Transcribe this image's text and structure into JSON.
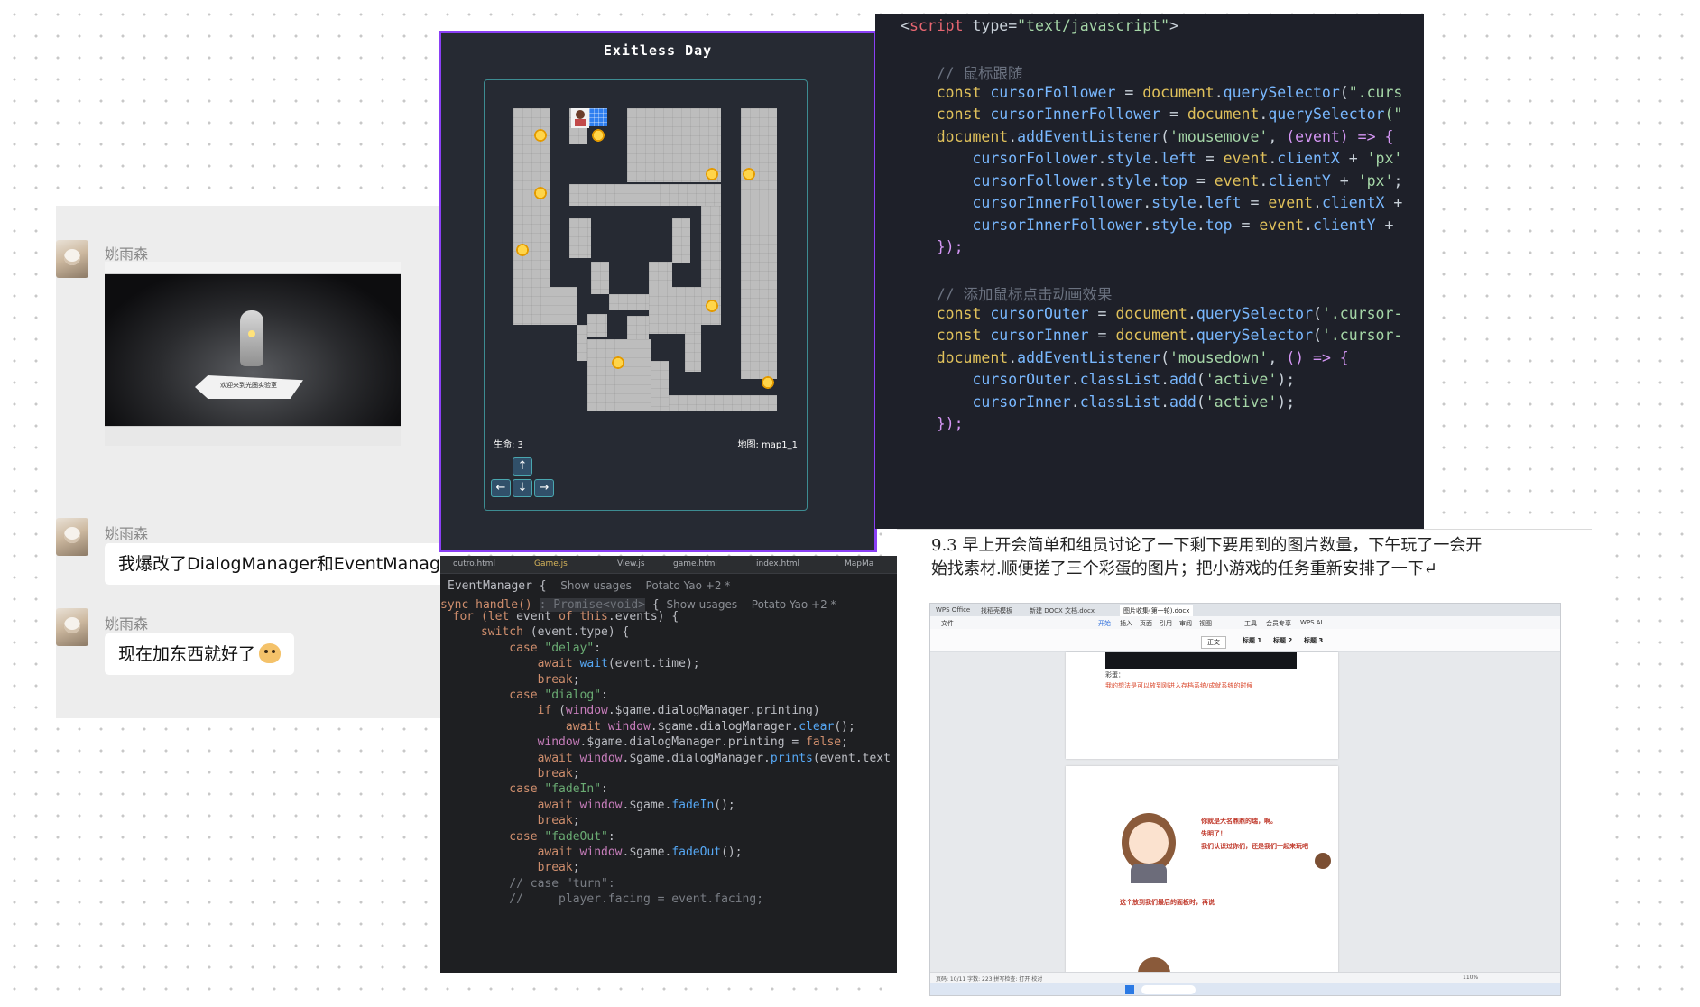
{
  "chat": {
    "messages": [
      {
        "sender": "姚雨森",
        "type": "image"
      },
      {
        "sender": "姚雨森",
        "text": "我爆改了DialogManager和EventManager"
      },
      {
        "sender": "姚雨森",
        "text": "现在加东西就好了"
      }
    ],
    "image_caption": "欢迎来到光圈实验室"
  },
  "game": {
    "title": "Exitless Day",
    "lives_label": "生命: 3",
    "map_label": "地图: map1_1",
    "controls": {
      "up": "↑",
      "left": "←",
      "down": "↓",
      "right": "→"
    },
    "colors": {
      "border": "#8a3ff5",
      "wall": "#bdbdbd",
      "goal": "#2f7ff0",
      "gem": "#f2b400"
    }
  },
  "codeA": {
    "lines": [
      [
        [
          "<",
          "#c9d1d9"
        ],
        [
          "script",
          "#e86671"
        ],
        [
          " type=",
          "#c9d1d9"
        ],
        [
          "\"text/javascript\"",
          "#a5d6a7"
        ],
        [
          ">",
          "#c9d1d9"
        ]
      ],
      [],
      [
        [
          "    // 鼠标跟随",
          "#6b7280"
        ]
      ],
      [
        [
          "    const ",
          "#e0c15b"
        ],
        [
          "cursorFollower",
          "#79b8ff"
        ],
        [
          " = ",
          "#c9d1d9"
        ],
        [
          "document",
          "#e0c15b"
        ],
        [
          ".",
          "#c9d1d9"
        ],
        [
          "querySelector",
          "#79b8ff"
        ],
        [
          "(",
          "#c9d1d9"
        ],
        [
          "\".curs",
          "#a5d6a7"
        ]
      ],
      [
        [
          "    const ",
          "#e0c15b"
        ],
        [
          "cursorInnerFollower",
          "#79b8ff"
        ],
        [
          " = ",
          "#c9d1d9"
        ],
        [
          "document",
          "#e0c15b"
        ],
        [
          ".",
          "#c9d1d9"
        ],
        [
          "querySelector",
          "#79b8ff"
        ],
        [
          "(\"",
          "#a5d6a7"
        ]
      ],
      [
        [
          "    document",
          "#e0c15b"
        ],
        [
          ".",
          "#c9d1d9"
        ],
        [
          "addEventListener",
          "#79b8ff"
        ],
        [
          "(",
          "#c9d1d9"
        ],
        [
          "'mousemove'",
          "#a5d6a7"
        ],
        [
          ", ",
          "#c9d1d9"
        ],
        [
          "(event) => {",
          "#d596f5"
        ]
      ],
      [
        [
          "        cursorFollower",
          "#79b8ff"
        ],
        [
          ".",
          "#c9d1d9"
        ],
        [
          "style",
          "#79b8ff"
        ],
        [
          ".",
          "#c9d1d9"
        ],
        [
          "left",
          "#79b8ff"
        ],
        [
          " = ",
          "#c9d1d9"
        ],
        [
          "event",
          "#e0c15b"
        ],
        [
          ".",
          "#c9d1d9"
        ],
        [
          "clientX",
          "#79b8ff"
        ],
        [
          " + ",
          "#c9d1d9"
        ],
        [
          "'px'",
          "#a5d6a7"
        ]
      ],
      [
        [
          "        cursorFollower",
          "#79b8ff"
        ],
        [
          ".",
          "#c9d1d9"
        ],
        [
          "style",
          "#79b8ff"
        ],
        [
          ".",
          "#c9d1d9"
        ],
        [
          "top",
          "#79b8ff"
        ],
        [
          " = ",
          "#c9d1d9"
        ],
        [
          "event",
          "#e0c15b"
        ],
        [
          ".",
          "#c9d1d9"
        ],
        [
          "clientY",
          "#79b8ff"
        ],
        [
          " + ",
          "#c9d1d9"
        ],
        [
          "'px'",
          "#a5d6a7"
        ],
        [
          ";",
          "#c9d1d9"
        ]
      ],
      [
        [
          "        cursorInnerFollower",
          "#79b8ff"
        ],
        [
          ".",
          "#c9d1d9"
        ],
        [
          "style",
          "#79b8ff"
        ],
        [
          ".",
          "#c9d1d9"
        ],
        [
          "left",
          "#79b8ff"
        ],
        [
          " = ",
          "#c9d1d9"
        ],
        [
          "event",
          "#e0c15b"
        ],
        [
          ".",
          "#c9d1d9"
        ],
        [
          "clientX",
          "#79b8ff"
        ],
        [
          " +",
          "#c9d1d9"
        ]
      ],
      [
        [
          "        cursorInnerFollower",
          "#79b8ff"
        ],
        [
          ".",
          "#c9d1d9"
        ],
        [
          "style",
          "#79b8ff"
        ],
        [
          ".",
          "#c9d1d9"
        ],
        [
          "top",
          "#79b8ff"
        ],
        [
          " = ",
          "#c9d1d9"
        ],
        [
          "event",
          "#e0c15b"
        ],
        [
          ".",
          "#c9d1d9"
        ],
        [
          "clientY",
          "#79b8ff"
        ],
        [
          " +",
          "#c9d1d9"
        ]
      ],
      [
        [
          "    });",
          "#d596f5"
        ]
      ],
      [],
      [
        [
          "    // 添加鼠标点击动画效果",
          "#6b7280"
        ]
      ],
      [
        [
          "    const ",
          "#e0c15b"
        ],
        [
          "cursorOuter",
          "#79b8ff"
        ],
        [
          " = ",
          "#c9d1d9"
        ],
        [
          "document",
          "#e0c15b"
        ],
        [
          ".",
          "#c9d1d9"
        ],
        [
          "querySelector",
          "#79b8ff"
        ],
        [
          "(",
          "#c9d1d9"
        ],
        [
          "'.cursor-",
          "#a5d6a7"
        ]
      ],
      [
        [
          "    const ",
          "#e0c15b"
        ],
        [
          "cursorInner",
          "#79b8ff"
        ],
        [
          " = ",
          "#c9d1d9"
        ],
        [
          "document",
          "#e0c15b"
        ],
        [
          ".",
          "#c9d1d9"
        ],
        [
          "querySelector",
          "#79b8ff"
        ],
        [
          "(",
          "#c9d1d9"
        ],
        [
          "'.cursor-",
          "#a5d6a7"
        ]
      ],
      [
        [
          "    document",
          "#e0c15b"
        ],
        [
          ".",
          "#c9d1d9"
        ],
        [
          "addEventListener",
          "#79b8ff"
        ],
        [
          "(",
          "#c9d1d9"
        ],
        [
          "'mousedown'",
          "#a5d6a7"
        ],
        [
          ", ",
          "#c9d1d9"
        ],
        [
          "() => {",
          "#d596f5"
        ]
      ],
      [
        [
          "        cursorOuter",
          "#79b8ff"
        ],
        [
          ".",
          "#c9d1d9"
        ],
        [
          "classList",
          "#79b8ff"
        ],
        [
          ".",
          "#c9d1d9"
        ],
        [
          "add",
          "#79b8ff"
        ],
        [
          "(",
          "#c9d1d9"
        ],
        [
          "'active'",
          "#a5d6a7"
        ],
        [
          ");",
          "#c9d1d9"
        ]
      ],
      [
        [
          "        cursorInner",
          "#79b8ff"
        ],
        [
          ".",
          "#c9d1d9"
        ],
        [
          "classList",
          "#79b8ff"
        ],
        [
          ".",
          "#c9d1d9"
        ],
        [
          "add",
          "#79b8ff"
        ],
        [
          "(",
          "#c9d1d9"
        ],
        [
          "'active'",
          "#a5d6a7"
        ],
        [
          ");",
          "#c9d1d9"
        ]
      ],
      [
        [
          "    });",
          "#d596f5"
        ]
      ]
    ]
  },
  "codeB": {
    "tabs": [
      "outro.html",
      "Game.js",
      "View.js",
      "game.html",
      "index.html",
      "MapMa"
    ],
    "header_class": "EventManager {",
    "header_usages": "Show usages",
    "header_author": "Potato Yao +2 *",
    "method_sig": "sync handle()",
    "method_hint": ": Promise<void>",
    "lines": [
      [
        [
          "  for (",
          "#cf8e6d"
        ],
        [
          "let ",
          "#cf8e6d"
        ],
        [
          "event ",
          "#bcbec4"
        ],
        [
          "of ",
          "#cf8e6d"
        ],
        [
          "this",
          "#cf8e6d"
        ],
        [
          ".events) {",
          "#bcbec4"
        ]
      ],
      [
        [
          "      switch ",
          "#cf8e6d"
        ],
        [
          "(event.type) {",
          "#bcbec4"
        ]
      ],
      [
        [
          "          case ",
          "#cf8e6d"
        ],
        [
          "\"delay\"",
          "#6aab73"
        ],
        [
          ":",
          "#bcbec4"
        ]
      ],
      [
        [
          "              await ",
          "#cf8e6d"
        ],
        [
          "wait",
          "#56a8f5"
        ],
        [
          "(event.time);",
          "#bcbec4"
        ]
      ],
      [
        [
          "              break",
          "#cf8e6d"
        ],
        [
          ";",
          "#bcbec4"
        ]
      ],
      [
        [
          "          case ",
          "#cf8e6d"
        ],
        [
          "\"dialog\"",
          "#6aab73"
        ],
        [
          ":",
          "#bcbec4"
        ]
      ],
      [
        [
          "              if ",
          "#cf8e6d"
        ],
        [
          "(",
          "#bcbec4"
        ],
        [
          "window",
          "#c77dbb"
        ],
        [
          ".$game.dialogManager.printing)",
          "#bcbec4"
        ]
      ],
      [
        [
          "                  await ",
          "#cf8e6d"
        ],
        [
          "window",
          "#c77dbb"
        ],
        [
          ".$game.dialogManager.",
          "#bcbec4"
        ],
        [
          "clear",
          "#56a8f5"
        ],
        [
          "();",
          "#bcbec4"
        ]
      ],
      [
        [
          "              window",
          "#c77dbb"
        ],
        [
          ".$game.dialogManager.printing = ",
          "#bcbec4"
        ],
        [
          "false",
          "#cf8e6d"
        ],
        [
          ";",
          "#bcbec4"
        ]
      ],
      [
        [
          "              await ",
          "#cf8e6d"
        ],
        [
          "window",
          "#c77dbb"
        ],
        [
          ".$game.dialogManager.",
          "#bcbec4"
        ],
        [
          "prints",
          "#56a8f5"
        ],
        [
          "(event.text",
          "#bcbec4"
        ]
      ],
      [
        [
          "              break",
          "#cf8e6d"
        ],
        [
          ";",
          "#bcbec4"
        ]
      ],
      [
        [
          "          case ",
          "#cf8e6d"
        ],
        [
          "\"fadeIn\"",
          "#6aab73"
        ],
        [
          ":",
          "#bcbec4"
        ]
      ],
      [
        [
          "              await ",
          "#cf8e6d"
        ],
        [
          "window",
          "#c77dbb"
        ],
        [
          ".$game.",
          "#bcbec4"
        ],
        [
          "fadeIn",
          "#56a8f5"
        ],
        [
          "();",
          "#bcbec4"
        ]
      ],
      [
        [
          "              break",
          "#cf8e6d"
        ],
        [
          ";",
          "#bcbec4"
        ]
      ],
      [
        [
          "          case ",
          "#cf8e6d"
        ],
        [
          "\"fadeOut\"",
          "#6aab73"
        ],
        [
          ":",
          "#bcbec4"
        ]
      ],
      [
        [
          "              await ",
          "#cf8e6d"
        ],
        [
          "window",
          "#c77dbb"
        ],
        [
          ".$game.",
          "#bcbec4"
        ],
        [
          "fadeOut",
          "#56a8f5"
        ],
        [
          "();",
          "#bcbec4"
        ]
      ],
      [
        [
          "              break",
          "#cf8e6d"
        ],
        [
          ";",
          "#bcbec4"
        ]
      ],
      [
        [
          "          // case \"turn\":",
          "#7a7e85"
        ]
      ],
      [
        [
          "          //     player.facing = event.facing;",
          "#7a7e85"
        ]
      ]
    ]
  },
  "doc": {
    "line1": "9.3 早上开会简单和组员讨论了一下剩下要用到的图片数量，下午玩了一会开",
    "line2": "始找素材.顺便搓了三个彩蛋的图片；把小游戏的任务重新安排了一下↵",
    "wps_tabs": [
      "WPS Office",
      "找稻壳模板",
      "新建 DOCX 文档.docx",
      "图片收集(第一轮).docx"
    ],
    "ribbon_menu": [
      "文件",
      "开始",
      "插入",
      "页面",
      "引用",
      "审阅",
      "视图",
      "工具",
      "会员专享",
      "WPS AI"
    ],
    "styles": [
      "正文",
      "标题 1",
      "标题 2",
      "标题 3"
    ],
    "page1_label": "彩蛋：",
    "page1_red": "我的想法是可以放到刚进入存档系统/成就系统的时候",
    "page2_line1": "你就是大名鼎鼎的瑞，啊。",
    "page2_line2": "失明了！",
    "page2_line3": "我们认识过你们，还是我们一起来玩吧",
    "page2_footer": "这个放到我们最后的面板时，再说",
    "statusbar": "页码: 10/11    字数: 223    拼写检查: 打开    校对",
    "zoom": "110%"
  }
}
